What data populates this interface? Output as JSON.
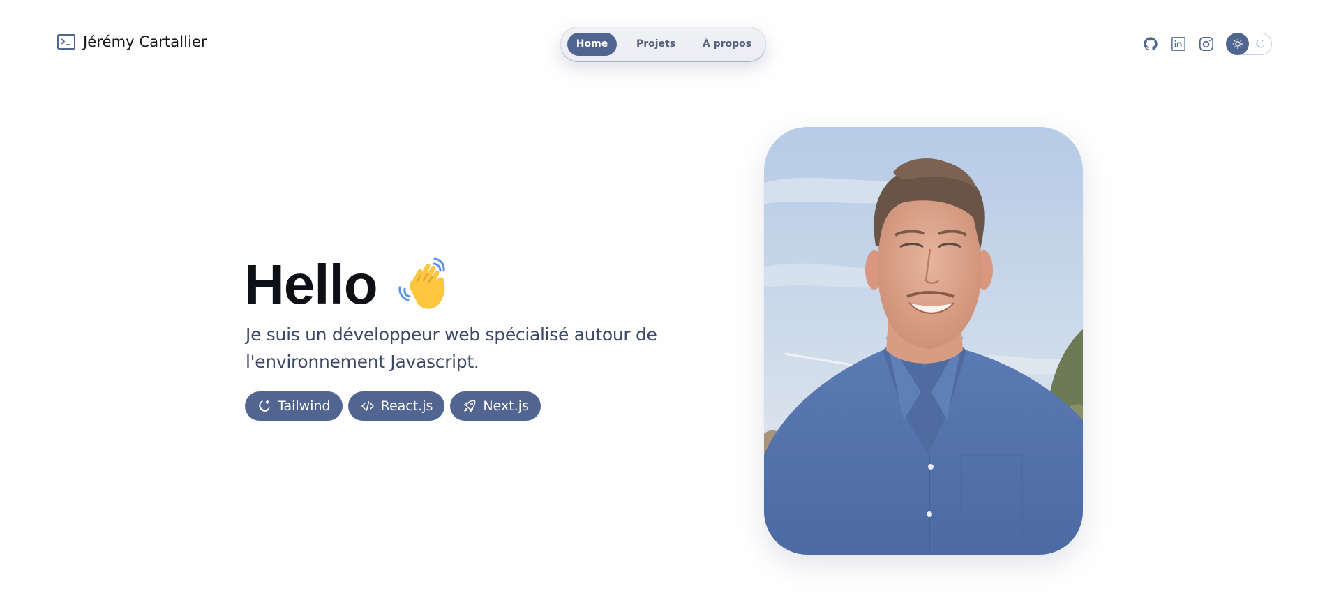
{
  "header": {
    "logo_icon": "terminal-icon",
    "site_name": "Jérémy Cartallier",
    "nav": [
      {
        "label": "Home",
        "active": true
      },
      {
        "label": "Projets",
        "active": false
      },
      {
        "label": "À propos",
        "active": false
      }
    ],
    "socials": [
      {
        "name": "github",
        "icon": "github-icon"
      },
      {
        "name": "linkedin",
        "icon": "linkedin-icon"
      },
      {
        "name": "instagram",
        "icon": "instagram-icon"
      }
    ],
    "theme_toggle": {
      "current": "light",
      "icons": [
        "sun-icon",
        "moon-icon"
      ]
    }
  },
  "hero": {
    "title": "Hello",
    "title_emoji": "waving-hand-icon",
    "subtitle": "Je suis un développeur web spécialisé autour de l'environnement Javascript.",
    "badges": [
      {
        "label": "Tailwind",
        "icon": "moon-stars-icon"
      },
      {
        "label": "React.js",
        "icon": "code-icon"
      },
      {
        "label": "Next.js",
        "icon": "rocket-icon"
      }
    ],
    "photo_alt": "Portrait photo of a smiling young man in a blue shirt outdoors"
  },
  "colors": {
    "accent": "#516591",
    "text": "#0e1015",
    "subtext": "#3d4866",
    "nav_bg": "#eef0f5",
    "toggle_border": "#c9cdf5"
  }
}
